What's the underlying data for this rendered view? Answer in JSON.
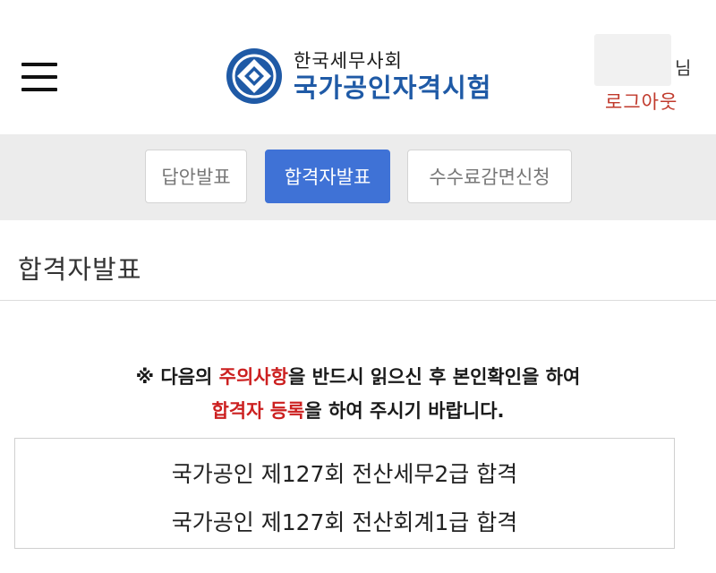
{
  "header": {
    "logo_sub": "한국세무사회",
    "logo_main": "국가공인자격시험",
    "user_suffix": "님",
    "logout_label": "로그아웃"
  },
  "tabs": [
    {
      "label": "답안발표",
      "active": false
    },
    {
      "label": "합격자발표",
      "active": true
    },
    {
      "label": "수수료감면신청",
      "active": false
    }
  ],
  "page_title": "합격자발표",
  "notice": {
    "prefix": "※ 다음의 ",
    "highlight1": "주의사항",
    "mid": "을 반드시 읽으신 후 본인확인을 하여",
    "highlight2": "합격자 등록",
    "suffix": "을 하여 주시기 바랍니다."
  },
  "results": [
    "국가공인 제127회 전산세무2급 합격",
    "국가공인 제127회 전산회계1급 합격"
  ],
  "colors": {
    "brand_blue": "#1f5aa6",
    "active_tab": "#3f72d6",
    "alert_red": "#cc2020",
    "logout_red": "#c0392b"
  }
}
